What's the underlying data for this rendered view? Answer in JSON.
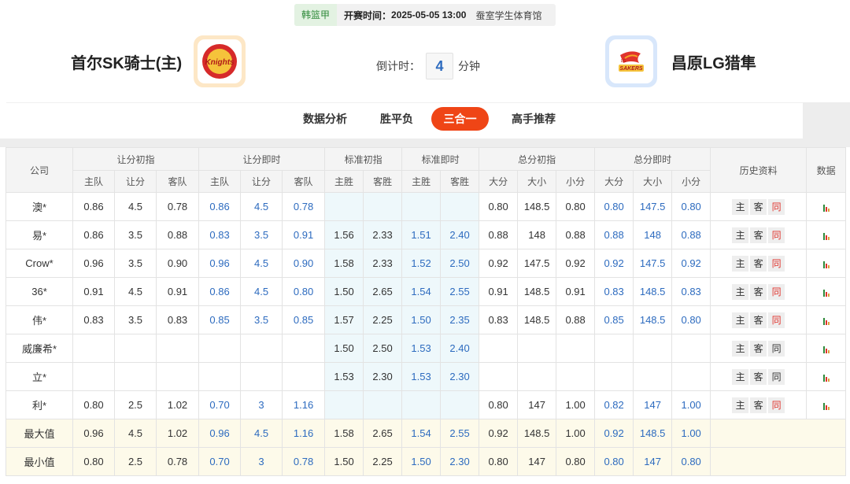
{
  "match": {
    "league": "韩篮甲",
    "start_label": "开赛时间：",
    "start_time": "2025-05-05 13:00",
    "venue": "蚕室学生体育馆",
    "home_team": "首尔SK骑士(主)",
    "away_team": "昌原LG猎隼",
    "home_logo_text": "Knights",
    "away_logo_text": "SAKERS",
    "away_logo_small": "LG",
    "countdown_label": "倒计时：",
    "countdown_value": "4",
    "countdown_unit": "分钟"
  },
  "tabs": [
    {
      "label": "数据分析",
      "active": false
    },
    {
      "label": "胜平负",
      "active": false
    },
    {
      "label": "三合一",
      "active": true
    },
    {
      "label": "高手推荐",
      "active": false
    }
  ],
  "table": {
    "headers": {
      "company": "公司",
      "handicap_initial": "让分初指",
      "handicap_live": "让分即时",
      "standard_initial": "标准初指",
      "standard_live": "标准即时",
      "total_initial": "总分初指",
      "total_live": "总分即时",
      "history": "历史资料",
      "data": "数据"
    },
    "subheaders": {
      "home": "主队",
      "handicap": "让分",
      "away": "客队",
      "home_win": "主胜",
      "away_win": "客胜",
      "over": "大分",
      "total": "大小",
      "under": "小分"
    },
    "history_buttons": [
      "主",
      "客",
      "同"
    ],
    "rows": [
      {
        "company": "澳*",
        "cells": [
          "0.86",
          "4.5",
          "0.78",
          "0.86",
          "4.5",
          "0.78",
          "",
          "",
          "",
          "",
          "0.80",
          "148.5",
          "0.80",
          "0.80",
          "147.5",
          "0.80"
        ],
        "same_hl": true
      },
      {
        "company": "易*",
        "cells": [
          "0.86",
          "3.5",
          "0.88",
          "0.83",
          "3.5",
          "0.91",
          "1.56",
          "2.33",
          "1.51",
          "2.40",
          "0.88",
          "148",
          "0.88",
          "0.88",
          "148",
          "0.88"
        ],
        "same_hl": true
      },
      {
        "company": "Crow*",
        "cells": [
          "0.96",
          "3.5",
          "0.90",
          "0.96",
          "4.5",
          "0.90",
          "1.58",
          "2.33",
          "1.52",
          "2.50",
          "0.92",
          "147.5",
          "0.92",
          "0.92",
          "147.5",
          "0.92"
        ],
        "same_hl": true
      },
      {
        "company": "36*",
        "cells": [
          "0.91",
          "4.5",
          "0.91",
          "0.86",
          "4.5",
          "0.80",
          "1.50",
          "2.65",
          "1.54",
          "2.55",
          "0.91",
          "148.5",
          "0.91",
          "0.83",
          "148.5",
          "0.83"
        ],
        "same_hl": true
      },
      {
        "company": "伟*",
        "cells": [
          "0.83",
          "3.5",
          "0.83",
          "0.85",
          "3.5",
          "0.85",
          "1.57",
          "2.25",
          "1.50",
          "2.35",
          "0.83",
          "148.5",
          "0.88",
          "0.85",
          "148.5",
          "0.80"
        ],
        "same_hl": true
      },
      {
        "company": "威廉希*",
        "cells": [
          "",
          "",
          "",
          "",
          "",
          "",
          "1.50",
          "2.50",
          "1.53",
          "2.40",
          "",
          "",
          "",
          "",
          "",
          ""
        ],
        "same_hl": false
      },
      {
        "company": "立*",
        "cells": [
          "",
          "",
          "",
          "",
          "",
          "",
          "1.53",
          "2.30",
          "1.53",
          "2.30",
          "",
          "",
          "",
          "",
          "",
          ""
        ],
        "same_hl": false
      },
      {
        "company": "利*",
        "cells": [
          "0.80",
          "2.5",
          "1.02",
          "0.70",
          "3",
          "1.16",
          "",
          "",
          "",
          "",
          "0.80",
          "147",
          "1.00",
          "0.82",
          "147",
          "1.00"
        ],
        "same_hl": true
      }
    ],
    "summary": [
      {
        "label": "最大值",
        "cells": [
          "0.96",
          "4.5",
          "1.02",
          "0.96",
          "4.5",
          "1.16",
          "1.58",
          "2.65",
          "1.54",
          "2.55",
          "0.92",
          "148.5",
          "1.00",
          "0.92",
          "148.5",
          "1.00"
        ]
      },
      {
        "label": "最小值",
        "cells": [
          "0.80",
          "2.5",
          "0.78",
          "0.70",
          "3",
          "0.78",
          "1.50",
          "2.25",
          "1.50",
          "2.30",
          "0.80",
          "147",
          "0.80",
          "0.80",
          "147",
          "0.80"
        ]
      }
    ]
  },
  "colors": {
    "accent": "#ef4516",
    "live_value": "#2d6bbf",
    "highlight": "#e0332c",
    "league_bg": "#e3f2e2",
    "standard_bg": "#eef8fb",
    "summary_bg": "#fdfaea"
  },
  "icons": {
    "home_logo": "knights-logo-icon",
    "away_logo": "sakers-logo-icon",
    "data_chart": "bar-chart-icon"
  }
}
